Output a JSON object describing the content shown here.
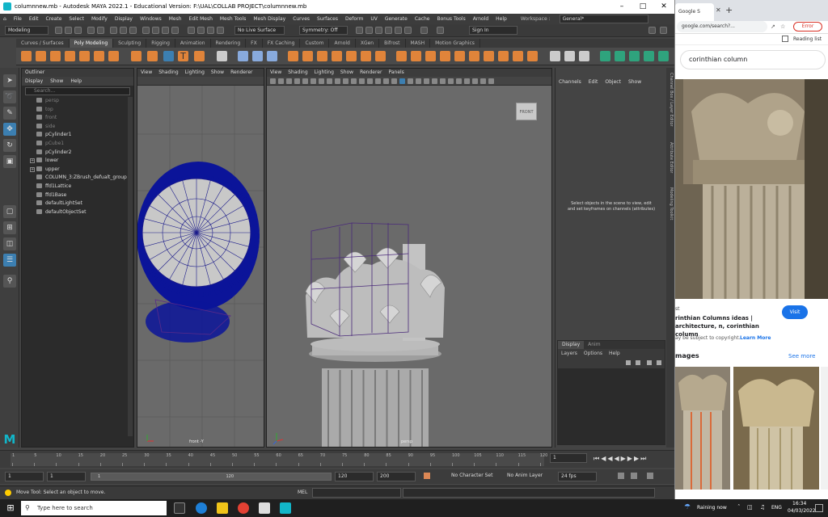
{
  "window": {
    "title": "columnnew.mb - Autodesk MAYA 2022.1 - Educational Version: F:\\UAL\\COLLAB PROJECT\\columnnew.mb"
  },
  "menus": [
    "File",
    "Edit",
    "Create",
    "Select",
    "Modify",
    "Display",
    "Windows",
    "Mesh",
    "Edit Mesh",
    "Mesh Tools",
    "Mesh Display",
    "Curves",
    "Surfaces",
    "Deform",
    "UV",
    "Generate",
    "Cache",
    "Bonus Tools",
    "Arnold",
    "Help"
  ],
  "workspace": {
    "label": "Workspace :",
    "value": "General*"
  },
  "status_line": {
    "menu_set": "Modeling",
    "live_surface": "No Live Surface",
    "symmetry": "Symmetry: Off",
    "sign_in": "Sign In"
  },
  "shelf_tabs": [
    "Curves / Surfaces",
    "Poly Modeling",
    "Sculpting",
    "Rigging",
    "Animation",
    "Rendering",
    "FX",
    "FX Caching",
    "Custom",
    "Arnold",
    "XGen",
    "Bifrost",
    "MASH",
    "Motion Graphics"
  ],
  "shelf_active": "Poly Modeling",
  "outliner": {
    "title": "Outliner",
    "menus": [
      "Display",
      "Show",
      "Help"
    ],
    "search_placeholder": "Search...",
    "items": [
      {
        "label": "persp",
        "dim": true
      },
      {
        "label": "top",
        "dim": true
      },
      {
        "label": "front",
        "dim": true
      },
      {
        "label": "side",
        "dim": true
      },
      {
        "label": "pCylinder1",
        "dim": false
      },
      {
        "label": "pCube1",
        "dim": true
      },
      {
        "label": "pCylinder2",
        "dim": false
      },
      {
        "label": "lower",
        "dim": false
      },
      {
        "label": "upper",
        "dim": false
      },
      {
        "label": "COLUMN_3:ZBrush_defualt_group",
        "dim": false
      },
      {
        "label": "ffd1Lattice",
        "dim": false
      },
      {
        "label": "ffd1Base",
        "dim": false
      },
      {
        "label": "defaultLightSet",
        "dim": false
      },
      {
        "label": "defaultObjectSet",
        "dim": false
      }
    ]
  },
  "viewport_front": {
    "menus": [
      "View",
      "Shading",
      "Lighting",
      "Show",
      "Renderer"
    ],
    "label": "front -Y"
  },
  "viewport_persp": {
    "menus": [
      "View",
      "Shading",
      "Lighting",
      "Show",
      "Renderer",
      "Panels"
    ],
    "label": "persp",
    "cube": "FRONT"
  },
  "channel_box": {
    "menus": [
      "Channels",
      "Edit",
      "Object",
      "Show"
    ],
    "message": "Select objects in the scene to view, edit and set keyframes on channels (attributes)",
    "side_tabs": [
      "Channel Box / Layer Editor",
      "Attribute Editor",
      "Modeling Toolkit"
    ]
  },
  "layer_editor": {
    "tabs": [
      "Display",
      "Anim"
    ],
    "menus": [
      "Layers",
      "Options",
      "Help"
    ]
  },
  "time_slider": {
    "ticks": [
      "1",
      "5",
      "10",
      "15",
      "20",
      "25",
      "30",
      "35",
      "40",
      "45",
      "50",
      "55",
      "60",
      "65",
      "70",
      "75",
      "80",
      "85",
      "90",
      "95",
      "100",
      "105",
      "110",
      "115",
      "120"
    ],
    "current_frame": "1"
  },
  "range_slider": {
    "start": "1",
    "range_start": "1",
    "range_bar_start": "1",
    "range_bar_end": "120",
    "range_end": "120",
    "end": "200",
    "character_set": "No Character Set",
    "anim_layer": "No Anim Layer",
    "fps": "24 fps"
  },
  "mel": {
    "label": "MEL",
    "help": "Move Tool: Select an object to move."
  },
  "browser": {
    "tab_title": "Google S",
    "url": "google.com/search?...",
    "error_label": "Error",
    "reading_list": "Reading list",
    "query": "corinthian column",
    "card_source": "st",
    "card_title": "rinthian Columns ideas | architecture, n, corinthian column",
    "copyright": "ay be subject to copyright.",
    "learn_more": "Learn More",
    "visit_label": "Visit",
    "related_heading": "mages",
    "see_more": "See more"
  },
  "taskbar": {
    "search_placeholder": "Type here to search",
    "weather": "Raining now",
    "lang": "ENG",
    "time": "16:34",
    "date": "04/03/2022"
  },
  "colors": {
    "maya_bg": "#444444",
    "wireframe_blue": "#0b1499",
    "selection_blue": "#3c7fb1",
    "lattice_purple": "#5a2a8a",
    "maya_logo": "#12b5c8"
  }
}
